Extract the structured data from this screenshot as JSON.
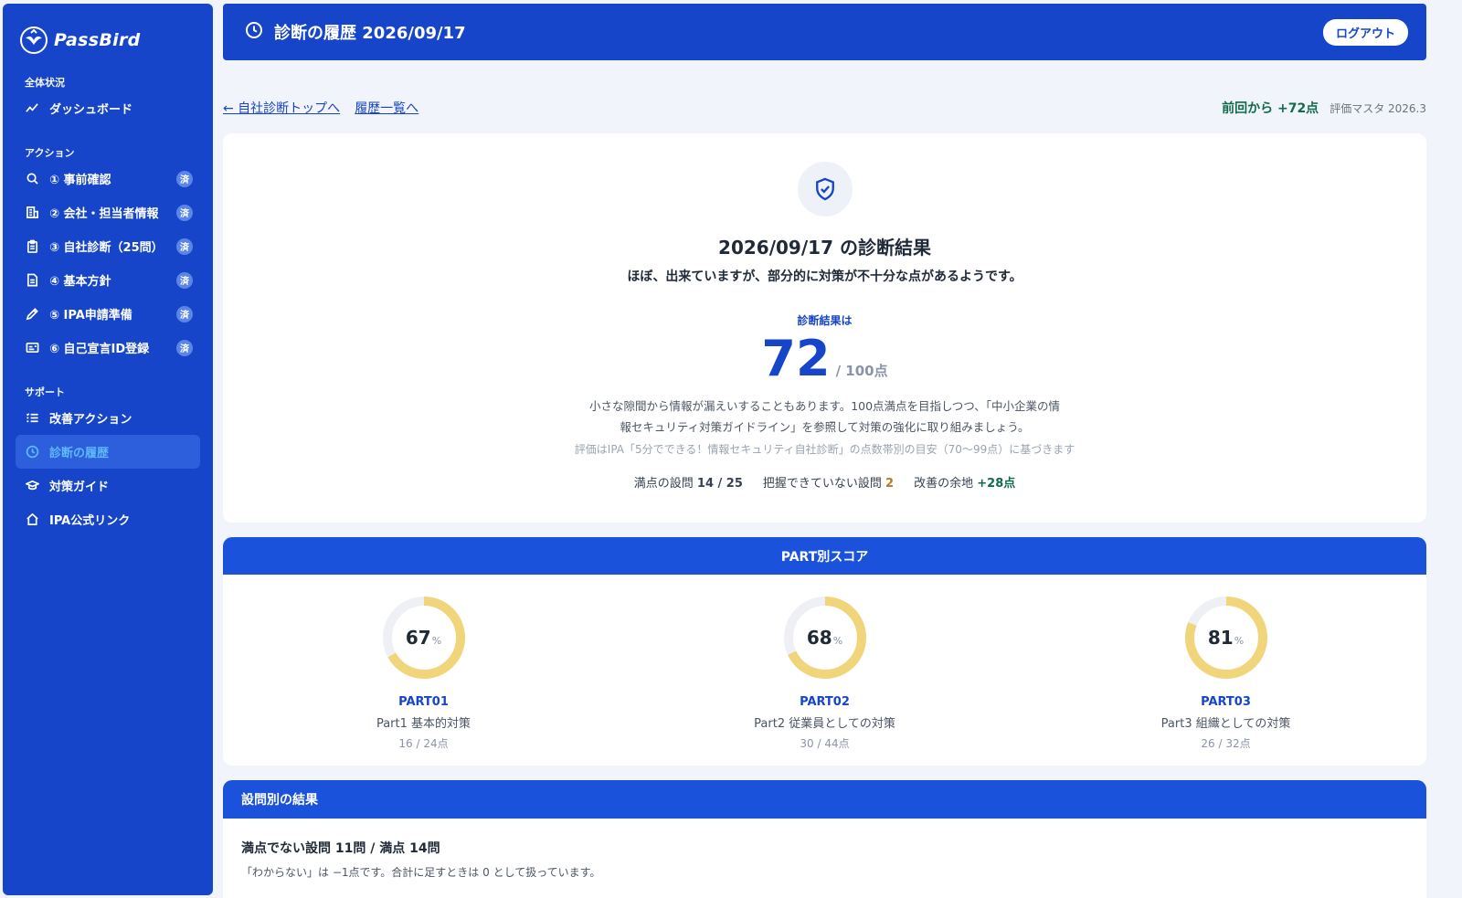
{
  "brand": {
    "name": "PassBird"
  },
  "sidebar": {
    "sections": [
      {
        "label": "全体状況",
        "items": [
          {
            "label": "ダッシュボード",
            "icon": "trend-line-icon"
          }
        ]
      },
      {
        "label": "アクション",
        "items": [
          {
            "label": "① 事前確認",
            "icon": "search-icon",
            "badge": "済"
          },
          {
            "label": "② 会社・担当者情報",
            "icon": "building-icon",
            "badge": "済"
          },
          {
            "label": "③ 自社診断（25問）",
            "icon": "clipboard-icon",
            "badge": "済"
          },
          {
            "label": "④ 基本方針",
            "icon": "document-icon",
            "badge": "済"
          },
          {
            "label": "⑤ IPA申請準備",
            "icon": "pencil-icon",
            "badge": "済"
          },
          {
            "label": "⑥ 自己宣言ID登録",
            "icon": "id-card-icon",
            "badge": "済"
          }
        ]
      },
      {
        "label": "サポート",
        "items": [
          {
            "label": "改善アクション",
            "icon": "checklist-icon"
          },
          {
            "label": "診断の履歴",
            "icon": "clock-icon",
            "active": true
          },
          {
            "label": "対策ガイド",
            "icon": "graduation-cap-icon"
          },
          {
            "label": "IPA公式リンク",
            "icon": "home-icon"
          }
        ]
      }
    ]
  },
  "header": {
    "title": "診断の履歴 2026/09/17",
    "logout_label": "ログアウト"
  },
  "subnav": {
    "back_link": "← 自社診断トップへ",
    "history_link": "履歴一覧へ",
    "delta": "前回から +72点",
    "master": "評価マスタ 2026.3"
  },
  "result": {
    "title": "2026/09/17 の診断結果",
    "subtitle": "ほぼ、出来ていますが、部分的に対策が不十分な点があるようです。",
    "score_label": "診断結果は",
    "score": "72",
    "score_total": "/ 100点",
    "advice_line1": "小さな隙間から情報が漏えいすることもあります。100点満点を目指しつつ、「中小企業の情",
    "advice_line2": "報セキュリティ対策ガイドライン」を参照して対策の強化に取り組みましょう。",
    "basis": "評価はIPA「5分でできる！情報セキュリティ自社診断」の点数帯別の目安（70〜99点）に基づきます",
    "stats": {
      "full_label": "満点の設問",
      "full_value": "14 / 25",
      "unknown_label": "把握できていない設問",
      "unknown_value": "2",
      "room_label": "改善の余地",
      "room_value": "+28点"
    }
  },
  "parts": {
    "heading": "PART別スコア",
    "items": [
      {
        "percent": 67,
        "percent_text": "67",
        "code": "PART01",
        "name": "Part1 基本的対策",
        "score": "16 / 24点"
      },
      {
        "percent": 68,
        "percent_text": "68",
        "code": "PART02",
        "name": "Part2 従業員としての対策",
        "score": "30 / 44点"
      },
      {
        "percent": 81,
        "percent_text": "81",
        "code": "PART03",
        "name": "Part3 組織としての対策",
        "score": "26 / 32点"
      }
    ],
    "percent_symbol": "%"
  },
  "questions": {
    "heading": "設問別の結果",
    "summary": "満点でない設問 11問 / 満点 14問",
    "note": "「わからない」は −1点です。合計に足すときは 0 として扱っています。"
  },
  "colors": {
    "primary": "#1645c9",
    "donut": "#f0d57a",
    "donut_track": "#eef0f5",
    "positive": "#0f6b4a",
    "warning": "#b7791f"
  }
}
